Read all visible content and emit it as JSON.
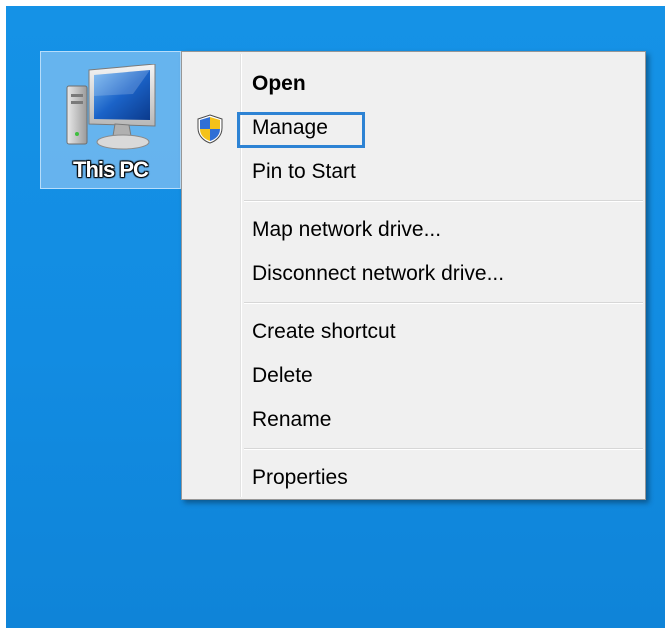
{
  "desktop": {
    "background_color": "#1592e6",
    "icon": {
      "label": "This PC",
      "icon_name": "computer-monitor-icon"
    }
  },
  "context_menu": {
    "items": [
      {
        "label": "Open",
        "bold": true
      },
      {
        "label": "Manage",
        "icon_name": "uac-shield-icon",
        "highlighted": true
      },
      {
        "label": "Pin to Start"
      },
      {
        "label": "Map network drive..."
      },
      {
        "label": "Disconnect network drive..."
      },
      {
        "label": "Create shortcut"
      },
      {
        "label": "Delete"
      },
      {
        "label": "Rename"
      },
      {
        "label": "Properties"
      }
    ],
    "highlight_color": "#2d83d4"
  }
}
